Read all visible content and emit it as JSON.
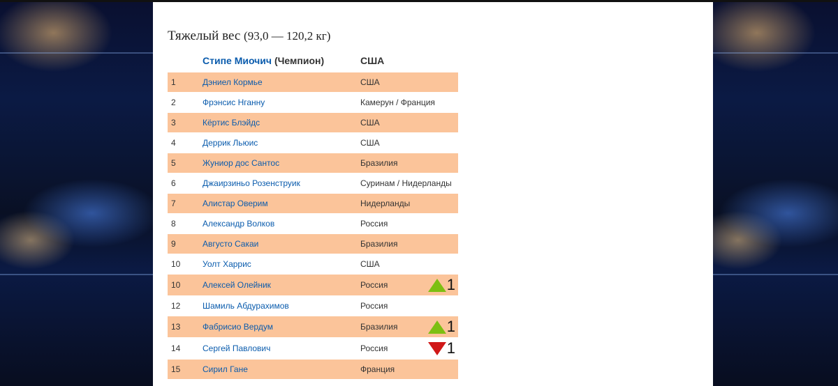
{
  "heading": {
    "title": "Тяжелый вес",
    "range": "(93,0 — 120,2 кг)"
  },
  "champion": {
    "name": "Стипе Миочич",
    "note": "(Чемпион)",
    "country": "США"
  },
  "colors": {
    "row_alt": "#fbc49a",
    "link": "#0b5cad",
    "up": "#7dbf12",
    "down": "#d01818"
  },
  "rows": [
    {
      "rank": "1",
      "name": "Дэниел Кормье",
      "country": "США"
    },
    {
      "rank": "2",
      "name": "Фрэнсис Нганну",
      "country": "Камерун / Франция"
    },
    {
      "rank": "3",
      "name": "Кёртис Блэйдс",
      "country": "США"
    },
    {
      "rank": "4",
      "name": "Деррик Льюис",
      "country": "США"
    },
    {
      "rank": "5",
      "name": "Жуниор дос Сантос",
      "country": "Бразилия"
    },
    {
      "rank": "6",
      "name": "Джаирзиньо Розенструик",
      "country": "Суринам / Нидерланды"
    },
    {
      "rank": "7",
      "name": "Алистар Оверим",
      "country": "Нидерланды"
    },
    {
      "rank": "8",
      "name": "Александр Волков",
      "country": "Россия"
    },
    {
      "rank": "9",
      "name": "Августо Сакаи",
      "country": "Бразилия"
    },
    {
      "rank": "10",
      "name": "Уолт Харрис",
      "country": "США"
    },
    {
      "rank": "10",
      "name": "Алексей Олейник",
      "country": "Россия",
      "move": "up",
      "move_value": "1"
    },
    {
      "rank": "12",
      "name": "Шамиль Абдурахимов",
      "country": "Россия"
    },
    {
      "rank": "13",
      "name": "Фабрисио Вердум",
      "country": "Бразилия",
      "move": "up",
      "move_value": "1"
    },
    {
      "rank": "14",
      "name": "Сергей Павлович",
      "country": "Россия",
      "move": "down",
      "move_value": "1"
    },
    {
      "rank": "15",
      "name": "Сирил Гане",
      "country": "Франция"
    }
  ]
}
